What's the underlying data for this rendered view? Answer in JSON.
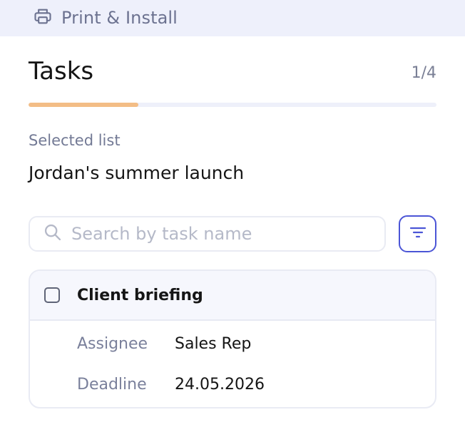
{
  "header": {
    "print_label": "Print & Install",
    "print_icon": "printer-icon"
  },
  "page": {
    "title": "Tasks",
    "step": "1/4",
    "progress": 0.27,
    "colors": {
      "progress_fill": "#f3bd86",
      "progress_track": "#eef0fa",
      "accent": "#4b55d6"
    }
  },
  "selected_list": {
    "label": "Selected list",
    "value": "Jordan's summer launch"
  },
  "search": {
    "placeholder": "Search by task name",
    "value": "",
    "icon": "search-icon"
  },
  "filter": {
    "icon": "filter-icon"
  },
  "tasks": [
    {
      "name": "Client briefing",
      "checked": false,
      "fields": [
        {
          "label": "Assignee",
          "value": "Sales Rep"
        },
        {
          "label": "Deadline",
          "value": "24.05.2026"
        }
      ]
    }
  ]
}
